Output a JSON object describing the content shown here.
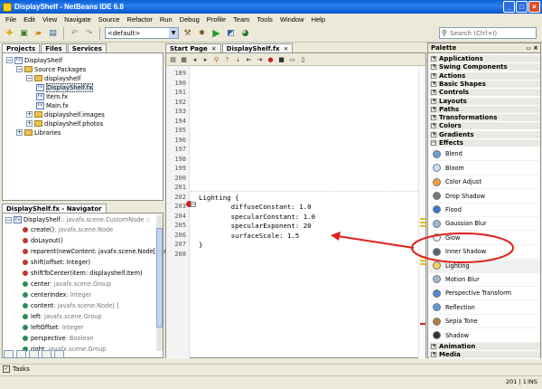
{
  "window": {
    "title": "DisplayShelf - NetBeans IDE 6.8"
  },
  "menu": [
    "File",
    "Edit",
    "View",
    "Navigate",
    "Source",
    "Refactor",
    "Run",
    "Debug",
    "Profile",
    "Team",
    "Tools",
    "Window",
    "Help"
  ],
  "toolbar": {
    "config_value": "<default>",
    "search_placeholder": "Search (Ctrl+I)"
  },
  "projects": {
    "tabs": [
      {
        "label": "Projects",
        "selected": true
      },
      {
        "label": "Files",
        "selected": false
      },
      {
        "label": "Services",
        "selected": false
      }
    ],
    "tree": [
      {
        "label": "DisplayShelf",
        "indent": 0,
        "icon": "project"
      },
      {
        "label": "Source Packages",
        "indent": 1,
        "icon": "folder"
      },
      {
        "label": "displayshelf",
        "indent": 2,
        "icon": "folder"
      },
      {
        "label": "DisplayShelf.fx",
        "indent": 3,
        "icon": "fx"
      },
      {
        "label": "Item.fx",
        "indent": 3,
        "icon": "fx"
      },
      {
        "label": "Main.fx",
        "indent": 3,
        "icon": "fx"
      },
      {
        "label": "displayshelf.images",
        "indent": 2,
        "icon": "folder"
      },
      {
        "label": "displayshelf.photos",
        "indent": 2,
        "icon": "folder"
      },
      {
        "label": "Libraries",
        "indent": 1,
        "icon": "folder"
      }
    ]
  },
  "navigator": {
    "title": "DisplayShelf.fx - Navigator",
    "root_name": "DisplayShelf",
    "root_type": " :: javafx.scene.CustomNode ::",
    "items": [
      {
        "name": "create()",
        "type": ": javafx.scene.Node",
        "color": "#c0392b"
      },
      {
        "name": "doLayout()",
        "type": "",
        "color": "#c0392b"
      },
      {
        "name": "reparent(newContent: javafx.scene.Node[ ], n",
        "type": "",
        "color": "#c0392b"
      },
      {
        "name": "shift(offset: Integer)",
        "type": "",
        "color": "#c0392b"
      },
      {
        "name": "shiftToCenter(item: displayshelf.Item)",
        "type": "",
        "color": "#c0392b"
      },
      {
        "name": "center",
        "type": ": javafx.scene.Group",
        "color": "#2e8b57"
      },
      {
        "name": "centerIndex",
        "type": ": Integer",
        "color": "#2e8b57"
      },
      {
        "name": "content",
        "type": ": javafx.scene.Node[ ]",
        "color": "#2e8b57"
      },
      {
        "name": "left",
        "type": ": javafx.scene.Group",
        "color": "#2e8b57"
      },
      {
        "name": "leftOffset",
        "type": ": Integer",
        "color": "#2e8b57"
      },
      {
        "name": "perspective",
        "type": ": Boolean",
        "color": "#2e8b57"
      },
      {
        "name": "right",
        "type": ": javafx.scene.Group",
        "color": "#2e8b57"
      }
    ]
  },
  "editor": {
    "tabs": [
      {
        "label": "Start Page",
        "selected": false
      },
      {
        "label": "DisplayShelf.fx",
        "selected": true
      }
    ],
    "lines": [
      {
        "num": "189",
        "code": ""
      },
      {
        "num": "190",
        "code": ""
      },
      {
        "num": "191",
        "code": ""
      },
      {
        "num": "192",
        "code": ""
      },
      {
        "num": "193",
        "code": ""
      },
      {
        "num": "194",
        "code": ""
      },
      {
        "num": "195",
        "code": ""
      },
      {
        "num": "196",
        "code": ""
      },
      {
        "num": "197",
        "code": ""
      },
      {
        "num": "198",
        "code": ""
      },
      {
        "num": "199",
        "code": ""
      },
      {
        "num": "200",
        "code": ""
      },
      {
        "num": "201",
        "code": ""
      },
      {
        "num": "202",
        "code": "Lighting {"
      },
      {
        "num": "203",
        "code": "        diffuseConstant: 1.0"
      },
      {
        "num": "204",
        "code": "        specularConstant: 1.0"
      },
      {
        "num": "205",
        "code": "        specularExponent: 20"
      },
      {
        "num": "206",
        "code": "        surfaceScale: 1.5"
      },
      {
        "num": "207",
        "code": "}"
      },
      {
        "num": "208",
        "code": ""
      }
    ]
  },
  "palette": {
    "title": "Palette",
    "categories_top": [
      "Applications",
      "Swing Components",
      "Actions",
      "Basic Shapes",
      "Controls",
      "Layouts",
      "Paths",
      "Transformations",
      "Colors",
      "Gradients"
    ],
    "effects_label": "Effects",
    "effects": [
      {
        "label": "Blend",
        "color": "#6aa0d8"
      },
      {
        "label": "Bloom",
        "color": "#c8e0ff"
      },
      {
        "label": "Color Adjust",
        "color": "#f0a030"
      },
      {
        "label": "Drop Shadow",
        "color": "#777777"
      },
      {
        "label": "Flood",
        "color": "#3a78c8"
      },
      {
        "label": "Gaussian Blur",
        "color": "#9cb8e0"
      },
      {
        "label": "Glow",
        "color": "#e8f0ff"
      },
      {
        "label": "Inner Shadow",
        "color": "#556677"
      },
      {
        "label": "Lighting",
        "color": "#f5d25a"
      },
      {
        "label": "Motion Blur",
        "color": "#a0b8d8"
      },
      {
        "label": "Perspective Transform",
        "color": "#4a8ad8"
      },
      {
        "label": "Reflection",
        "color": "#5a9ae0"
      },
      {
        "label": "Sepia Tone",
        "color": "#b08040"
      },
      {
        "label": "Shadow",
        "color": "#333333"
      }
    ],
    "categories_bottom": [
      "Animation",
      "Media"
    ]
  },
  "status": {
    "tasks_label": "Tasks",
    "position": "201 | 1",
    "mode": "INS"
  },
  "colors": {
    "annotation": "#e0201c",
    "selection": "#dce6f4"
  }
}
